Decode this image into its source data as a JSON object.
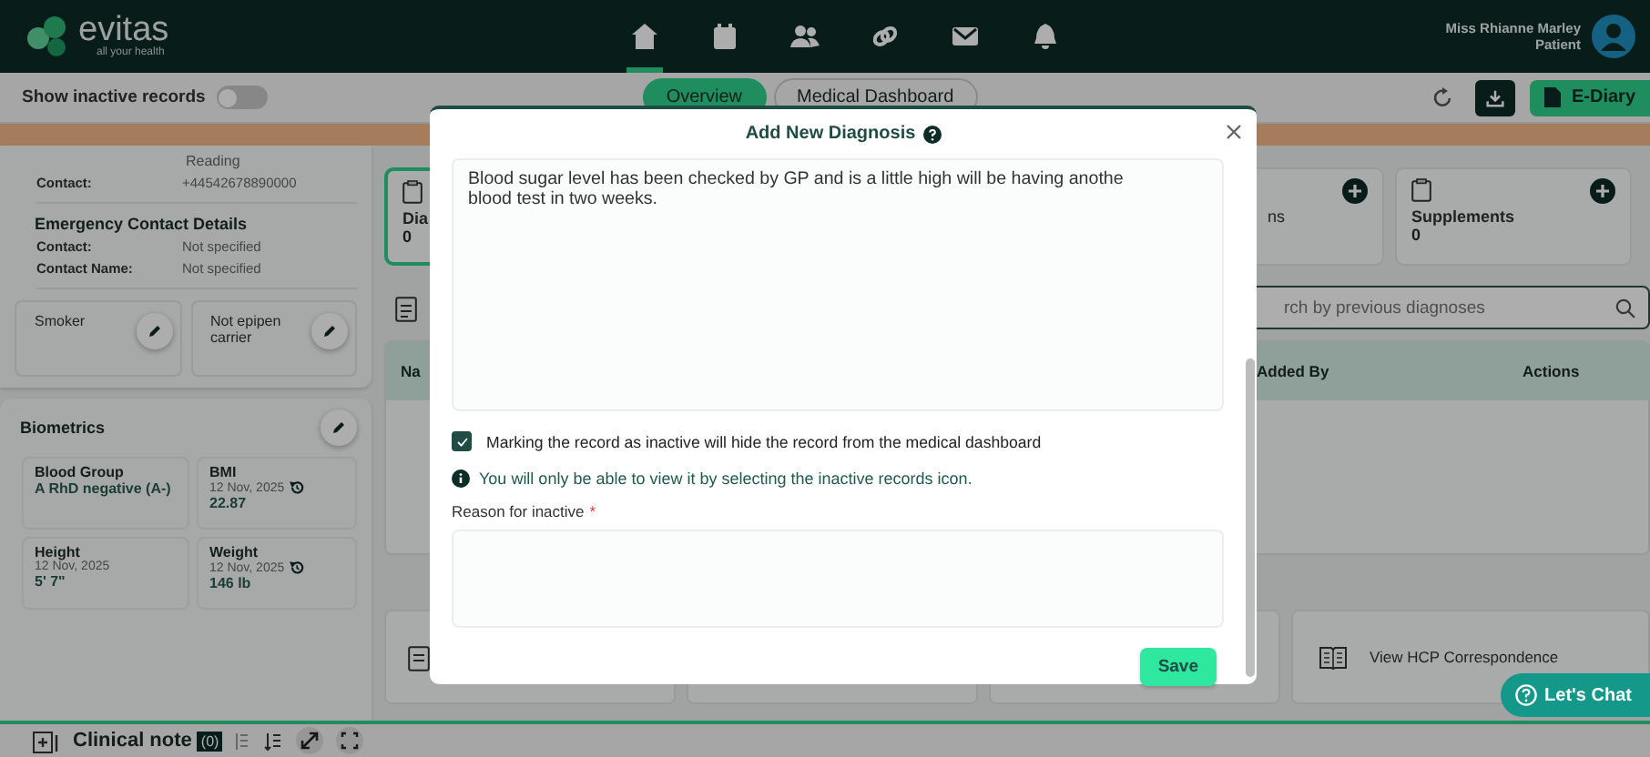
{
  "header": {
    "logo": "evitas",
    "tagline": "all your health",
    "nav": [
      {
        "kind": "home",
        "selected": true
      },
      {
        "kind": "calendar",
        "selected": false
      },
      {
        "kind": "users",
        "selected": false
      },
      {
        "kind": "link",
        "selected": false
      },
      {
        "kind": "mail",
        "selected": false
      },
      {
        "kind": "bell",
        "selected": false
      }
    ],
    "user": {
      "name": "Miss Rhianne Marley",
      "role": "Patient"
    }
  },
  "toolbar": {
    "toggle": {
      "label": "Show inactive records",
      "on": false
    },
    "tabs": [
      {
        "label": "Overview",
        "selected": true
      },
      {
        "label": "Medical Dashboard",
        "selected": false
      }
    ],
    "ediary": "E-Diary"
  },
  "left": {
    "reading": "Reading",
    "contact": {
      "label": "Contact:",
      "value": "+44542678890000"
    },
    "emergency": {
      "title": "Emergency Contact Details",
      "rows": [
        {
          "label": "Contact:",
          "value": "Not specified"
        },
        {
          "label": "Contact Name:",
          "value": "Not specified"
        }
      ]
    },
    "flags": [
      "Smoker",
      "Not epipen carrier"
    ],
    "biometrics": {
      "title": "Biometrics",
      "items": [
        {
          "label": "Blood Group",
          "value": "A RhD negative (A-)"
        },
        {
          "label": "BMI",
          "date": "12 Nov, 2025",
          "value": "22.87",
          "history": true
        },
        {
          "label": "Height",
          "date": "12 Nov, 2025",
          "value": "5' 7\""
        },
        {
          "label": "Weight",
          "date": "12 Nov, 2025",
          "value": "146 lb",
          "history": true
        }
      ]
    }
  },
  "main": {
    "cards": [
      {
        "label": "Dia",
        "count": "0",
        "selected": true
      },
      {
        "label": "ns",
        "selected": false,
        "add": true
      },
      {
        "label": "Supplements",
        "count": "0",
        "selected": false,
        "add": true
      }
    ],
    "search": {
      "placeholder": "rch by previous diagnoses"
    },
    "table": {
      "columns": [
        "Na",
        "Added By",
        "Actions"
      ]
    },
    "links": [
      "View HCP Correspondence"
    ]
  },
  "chat": "Let's Chat",
  "clinical": {
    "title": "Clinical note",
    "count": "(0)"
  },
  "modal": {
    "title": "Add New Diagnosis",
    "notes": "Blood sugar level has been checked by GP and is a little high will be having anothe blood test in two weeks.",
    "checkbox": {
      "label": "Marking the record as inactive will hide the record from the medical dashboard",
      "checked": true
    },
    "info": "You will only be able to view it by selecting the inactive records icon.",
    "reason": {
      "label": "Reason for inactive",
      "required_mark": "*"
    },
    "save": "Save"
  }
}
